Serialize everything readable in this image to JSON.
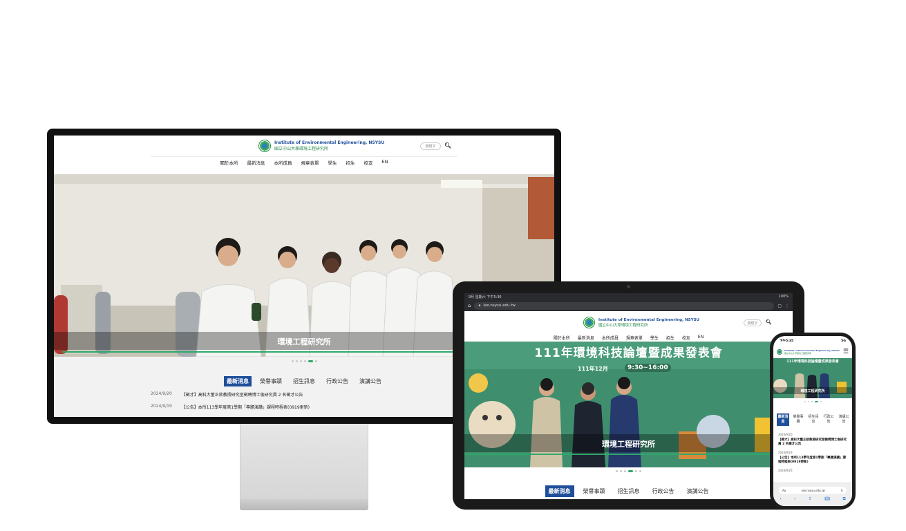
{
  "site": {
    "name_en": "Institute of Environmental Engineering, NSYSU",
    "name_zh": "國立中山大學環境工程研究所",
    "search_placeholder": "關鍵字",
    "nav": [
      "關於本所",
      "最新消息",
      "本所成員",
      "規章表單",
      "學生",
      "招生",
      "校友",
      "EN"
    ],
    "hero_caption": "環境工程研究所",
    "tablet_banner_title": "111年環境科技論壇暨成果發表會",
    "tablet_banner_date": "111年12月",
    "tablet_banner_time": "9:30~16:00",
    "tabs": [
      "最新消息",
      "榮譽事蹟",
      "招生訊息",
      "行政公告",
      "演講公告"
    ],
    "news": [
      {
        "date": "2024/9/20",
        "title": "【徵才】高科大董正欽教授研究室徵聘博士後研究員 2 名徵才公告"
      },
      {
        "date": "2024/9/19",
        "title": "【公告】本所113學年度第1學期「專題演講」課程時程表(0919更新)"
      },
      {
        "date": "2024/9/26",
        "title": ""
      }
    ]
  },
  "tablet": {
    "status_left": "9月 星期六 下午5:36",
    "status_right": "100%",
    "url": "iee.nsysu.edu.tw"
  },
  "phone": {
    "time": "下午5:35",
    "signal": "5G",
    "tabs_wrapped": [
      "最新消息",
      "榮譽事蹟",
      "招生訊息",
      "行政公告",
      "演講公告"
    ],
    "url_label": "Aa",
    "url": "iee.nsysu.edu.tw"
  },
  "colors": {
    "brand_blue": "#1f4f9a",
    "brand_green": "#2fa86a",
    "bezel": "#111111"
  },
  "icons": [
    "search-icon",
    "home-icon",
    "lock-icon",
    "tabs-icon",
    "menu-icon",
    "reload-icon",
    "back-icon",
    "forward-icon",
    "share-icon",
    "bookmarks-icon"
  ]
}
